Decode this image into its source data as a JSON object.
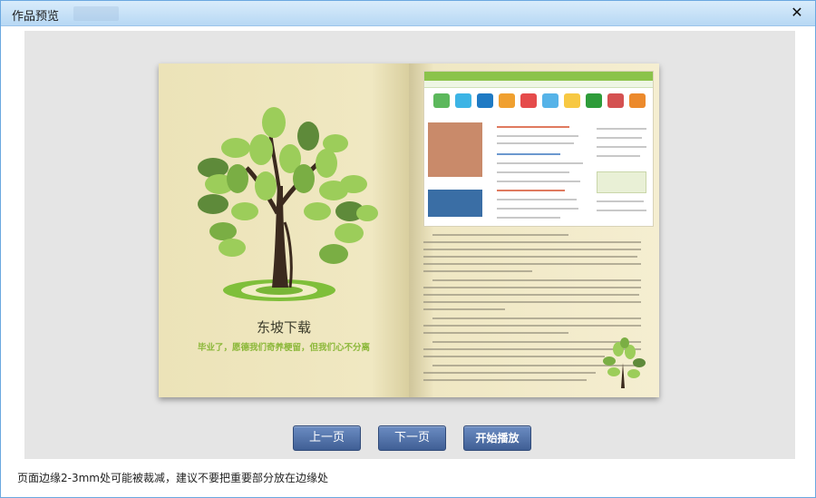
{
  "window": {
    "title": "作品预览",
    "close_icon": "close-icon"
  },
  "book": {
    "title": "东坡下载",
    "slogan": "毕业了，愿德我们奇养梗留，但我们心不分离"
  },
  "controls": {
    "prev_label": "上一页",
    "next_label": "下一页",
    "play_label": "开始播放"
  },
  "footer": {
    "note": "页面边缘2-3mm处可能被裁减，建议不要把重要部分放在边缘处"
  },
  "colors": {
    "title_bar": "#b7d8f4",
    "button": "#4d6ea6",
    "page": "#efe6bd",
    "leaf_light": "#9ccd5a",
    "leaf_dark": "#5e8a3a",
    "trunk": "#3b2a1e",
    "slogan": "#8cb83a"
  }
}
